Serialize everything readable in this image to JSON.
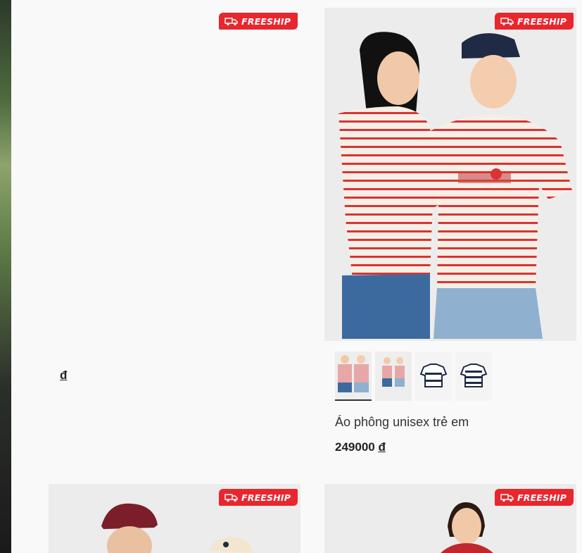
{
  "colors": {
    "badge": "#e8262e",
    "page_bg": "#f9f9f9",
    "stripe_red": "#d93333",
    "denim": "#3d6a9e",
    "cap_navy": "#1f2a44",
    "cap_burgundy": "#7b1e2a"
  },
  "badges": {
    "freeship": "FREESHIP"
  },
  "icons": {
    "badge_icon": "delivery-truck-icon"
  },
  "products": [
    {
      "title": "",
      "price_value": "",
      "currency": "đ"
    },
    {
      "title": "Áo phông unisex trẻ em",
      "price_value": "249000",
      "currency": "đ",
      "thumbnails": [
        "pair-front-thumb",
        "pair-full-thumb",
        "tee-white-navy-thumb",
        "tee-white-navy-back-thumb"
      ]
    },
    {
      "title": "",
      "price_value": "",
      "currency": ""
    },
    {
      "title": "",
      "price_value": "",
      "currency": ""
    }
  ]
}
